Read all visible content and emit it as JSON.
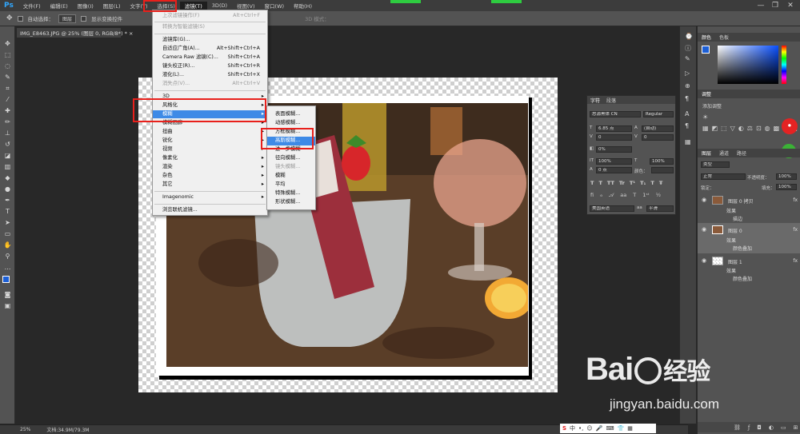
{
  "app": {
    "logo": "Ps"
  },
  "menubar": {
    "items": [
      "文件(F)",
      "编辑(E)",
      "图像(I)",
      "图层(L)",
      "文字(Y)",
      "选择(S)",
      "滤镜(T)",
      "3D(D)",
      "视图(V)",
      "窗口(W)",
      "帮助(H)"
    ],
    "window_controls": [
      "—",
      "❐",
      "✕"
    ]
  },
  "options_bar": {
    "auto_select_label": "自动选择：",
    "auto_select_value": "图层",
    "show_transform_label": "显示变换控件",
    "mode_label": "3D 模式："
  },
  "document_tab": {
    "title": "IMG_E8463.JPG @ 25% (图层 0, RGB/8*) *",
    "close": "×"
  },
  "status_bar": {
    "zoom": "25%",
    "doc_size": "文档:34.9M/79.3M"
  },
  "filter_menu": {
    "items": [
      {
        "label": "上次滤镜操作(F)",
        "shortcut": "Alt+Ctrl+F",
        "disabled": true
      },
      {
        "label": "转换为智能滤镜(S)",
        "shortcut": "",
        "disabled": true
      },
      {
        "label": "滤镜库(G)...",
        "shortcut": ""
      },
      {
        "label": "自适应广角(A)...",
        "shortcut": "Alt+Shift+Ctrl+A"
      },
      {
        "label": "Camera Raw 滤镜(C)...",
        "shortcut": "Shift+Ctrl+A"
      },
      {
        "label": "镜头校正(R)...",
        "shortcut": "Shift+Ctrl+R"
      },
      {
        "label": "液化(L)...",
        "shortcut": "Shift+Ctrl+X"
      },
      {
        "label": "消失点(V)...",
        "shortcut": "Alt+Ctrl+V",
        "disabled": true
      },
      {
        "label": "3D",
        "shortcut": "",
        "submenu": true
      },
      {
        "label": "风格化",
        "shortcut": "",
        "submenu": true
      },
      {
        "label": "模糊",
        "shortcut": "",
        "submenu": true,
        "highlighted": true
      },
      {
        "label": "模糊画廊",
        "shortcut": "",
        "submenu": true
      },
      {
        "label": "扭曲",
        "shortcut": "",
        "submenu": true
      },
      {
        "label": "锐化",
        "shortcut": "",
        "submenu": true
      },
      {
        "label": "视频",
        "shortcut": "",
        "submenu": true
      },
      {
        "label": "像素化",
        "shortcut": "",
        "submenu": true
      },
      {
        "label": "渲染",
        "shortcut": "",
        "submenu": true
      },
      {
        "label": "杂色",
        "shortcut": "",
        "submenu": true
      },
      {
        "label": "其它",
        "shortcut": "",
        "submenu": true
      },
      {
        "label": "Imagenomic",
        "shortcut": "",
        "submenu": true
      },
      {
        "label": "浏览联机滤镜...",
        "shortcut": ""
      }
    ]
  },
  "blur_submenu": {
    "items": [
      {
        "label": "表面模糊..."
      },
      {
        "label": "动感模糊..."
      },
      {
        "label": "方框模糊...",
        "partial": true
      },
      {
        "label": "高斯模糊...",
        "highlighted": true
      },
      {
        "label": "进一步模糊"
      },
      {
        "label": "径向模糊..."
      },
      {
        "label": "镜头模糊...",
        "disabled": true
      },
      {
        "label": "模糊"
      },
      {
        "label": "平均"
      },
      {
        "label": "特殊模糊..."
      },
      {
        "label": "形状模糊..."
      }
    ]
  },
  "character_panel": {
    "tabs": [
      "字符",
      "段落"
    ],
    "font_family": "思源黑体 CN",
    "font_style": "Regular",
    "font_size": "6.85 点",
    "leading": "(自动)",
    "kerning": "0",
    "tracking": "0",
    "scale_percent": "0%",
    "vertical_scale": "100%",
    "horizontal_scale": "100%",
    "baseline": "0 点",
    "color_label": "颜色：",
    "language": "美国英语",
    "antialias": "平滑",
    "style_buttons": [
      "T",
      "T",
      "TT",
      "Tr",
      "T¹",
      "T₁",
      "T",
      "Ŧ"
    ]
  },
  "right_panel": {
    "color_tabs": [
      "颜色",
      "色板"
    ],
    "adjust_tab": "调整",
    "adjust_title": "添加调整",
    "layers_tabs": [
      "图层",
      "通道",
      "路径"
    ],
    "kind_filter": "类型",
    "blend_mode": "正常",
    "opacity_label": "不透明度：",
    "opacity_value": "100%",
    "lock_label": "锁定：",
    "fill_label": "填充：",
    "fill_value": "100%",
    "layers": [
      {
        "name": "图层 0 拷贝",
        "effects_label": "效果",
        "effect": "描边"
      },
      {
        "name": "图层 0",
        "effects_label": "效果",
        "effect": "颜色叠加"
      },
      {
        "name": "图层 1",
        "effects_label": "效果",
        "effect": "颜色叠加"
      }
    ],
    "fx": "fx"
  },
  "watermark": {
    "brand": "Bai",
    "brand2": "经验",
    "url": "jingyan.baidu.com"
  },
  "colors": {
    "accent": "#3e8ae6",
    "highlight_box": "#e8201b",
    "fg_swatch": "#1c5fd6"
  }
}
